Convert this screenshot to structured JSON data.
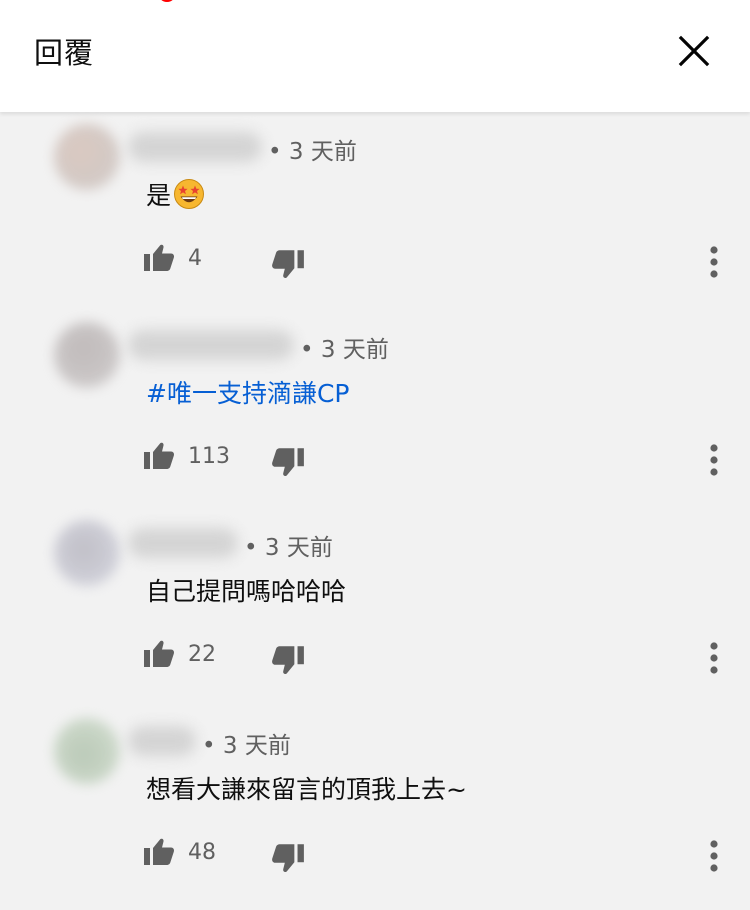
{
  "header": {
    "title": "回覆"
  },
  "colors": {
    "link": "#065fd4",
    "meta": "#606060",
    "notification": "#ff0000"
  },
  "comments": [
    {
      "time": "• 3 天前",
      "text": "是",
      "emoji": "star-struck",
      "likes": "4",
      "link": false
    },
    {
      "time": "• 3 天前",
      "text": "#唯一支持滴謙CP",
      "likes": "113",
      "link": true
    },
    {
      "time": "• 3 天前",
      "text": "自己提問嗎哈哈哈",
      "likes": "22",
      "link": false
    },
    {
      "time": "• 3 天前",
      "text": "想看大謙來留言的頂我上去~",
      "likes": "48",
      "link": false
    }
  ]
}
